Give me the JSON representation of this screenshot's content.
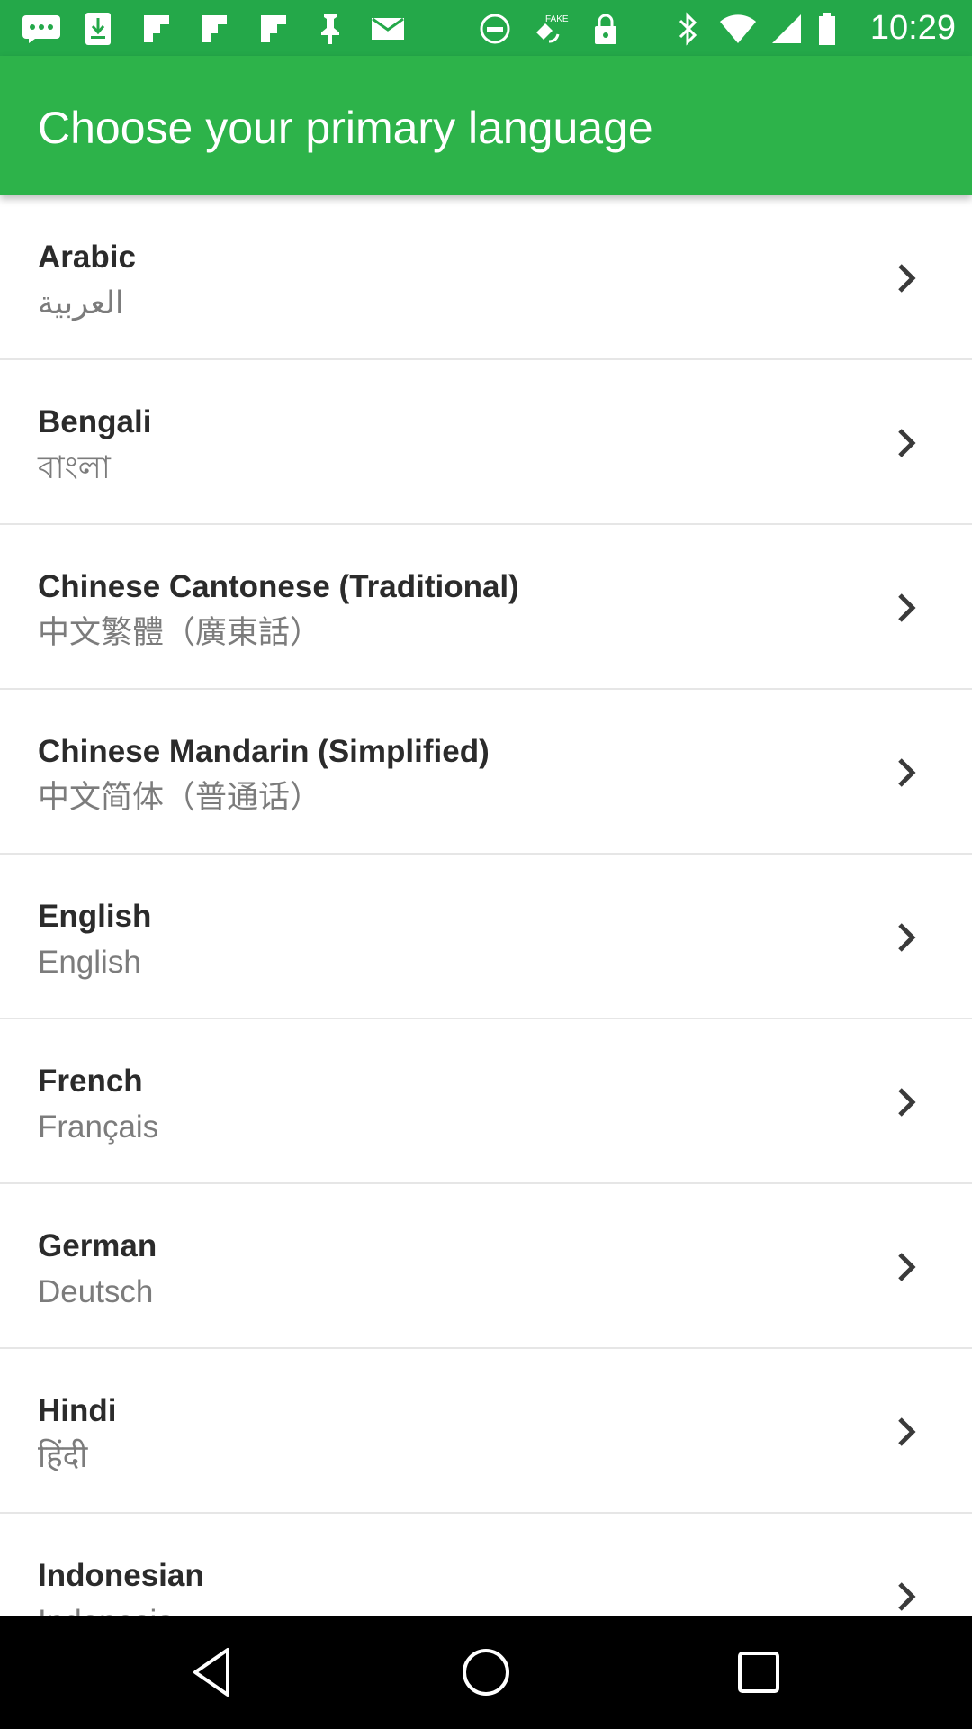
{
  "status_bar": {
    "time": "10:29",
    "left_icons": [
      "message-icon",
      "download-icon",
      "flipboard-icon",
      "flipboard-icon",
      "pin-icon",
      "mail-icon",
      "blocked-icon",
      "fake-gps-icon",
      "lock-icon"
    ],
    "right_icons": [
      "bluetooth-icon",
      "wifi-icon",
      "signal-icon",
      "battery-icon"
    ]
  },
  "header": {
    "title": "Choose your primary language"
  },
  "languages": [
    {
      "name": "Arabic",
      "native": "العربية"
    },
    {
      "name": "Bengali",
      "native": "বাংলা"
    },
    {
      "name": "Chinese Cantonese (Traditional)",
      "native": "中文繁體（廣東話）"
    },
    {
      "name": "Chinese Mandarin (Simplified)",
      "native": "中文简体（普通话）"
    },
    {
      "name": "English",
      "native": "English"
    },
    {
      "name": "French",
      "native": "Français"
    },
    {
      "name": "German",
      "native": "Deutsch"
    },
    {
      "name": "Hindi",
      "native": "हिंदी"
    },
    {
      "name": "Indonesian",
      "native": "Indonesia"
    }
  ],
  "nav_bar": {
    "buttons": [
      "back-icon",
      "home-icon",
      "recents-icon"
    ]
  },
  "colors": {
    "accent": "#2db34a",
    "status_bar": "#24a849",
    "primary_text": "#2b2b2b",
    "secondary_text": "#7c7c7c",
    "divider": "#e6e6e6"
  }
}
